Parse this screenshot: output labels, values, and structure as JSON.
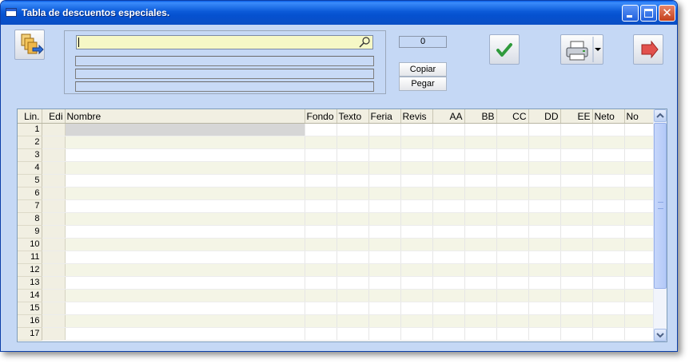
{
  "window": {
    "title": "Tabla de descuentos especiales."
  },
  "toolbar": {
    "search_value": "",
    "counter_value": "0",
    "copy_label": "Copiar",
    "paste_label": "Pegar",
    "icons": [
      "copy-documents-icon",
      "check-icon",
      "printer-icon",
      "exit-arrow-icon"
    ]
  },
  "grid": {
    "columns": [
      "Lin.",
      "Edi",
      "Nombre",
      "Fondo",
      "Texto",
      "Feria",
      "Revis",
      "AA",
      "BB",
      "CC",
      "DD",
      "EE",
      "Neto",
      "No"
    ],
    "rows": [
      "1",
      "2",
      "3",
      "4",
      "5",
      "6",
      "7",
      "8",
      "9",
      "10",
      "11",
      "12",
      "13",
      "14",
      "15",
      "16",
      "17"
    ]
  },
  "colors": {
    "window_bg": "#c5d8f5",
    "title_bar": "#0a5fe8",
    "search_bg": "#f6f8c6",
    "row_alt": "#f4f5e6"
  }
}
